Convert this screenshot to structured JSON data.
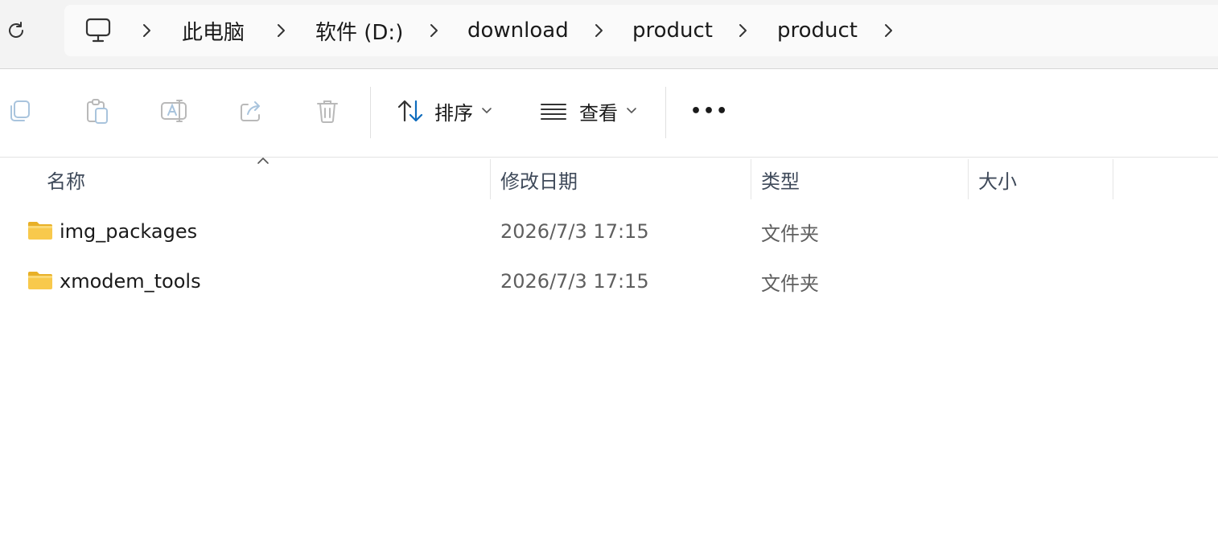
{
  "breadcrumb": {
    "root_icon": "computer-icon",
    "items": [
      {
        "label": "此电脑"
      },
      {
        "label": "软件 (D:)"
      },
      {
        "label": "download"
      },
      {
        "label": "product"
      },
      {
        "label": "product"
      }
    ]
  },
  "toolbar": {
    "icons": [
      "copy-icon",
      "paste-icon",
      "rename-icon",
      "share-icon",
      "delete-icon"
    ],
    "sort_label": "排序",
    "view_label": "查看",
    "more_label": "•••"
  },
  "columns": {
    "name": "名称",
    "modified": "修改日期",
    "type": "类型",
    "size": "大小"
  },
  "files": [
    {
      "name": "img_packages",
      "modified": "2026/7/3 17:15",
      "type": "文件夹",
      "size": ""
    },
    {
      "name": "xmodem_tools",
      "modified": "2026/7/3 17:15",
      "type": "文件夹",
      "size": ""
    }
  ],
  "colors": {
    "accent": "#0f6cbd",
    "folder": "#f8c94c",
    "header_text": "#3f4a5a"
  }
}
